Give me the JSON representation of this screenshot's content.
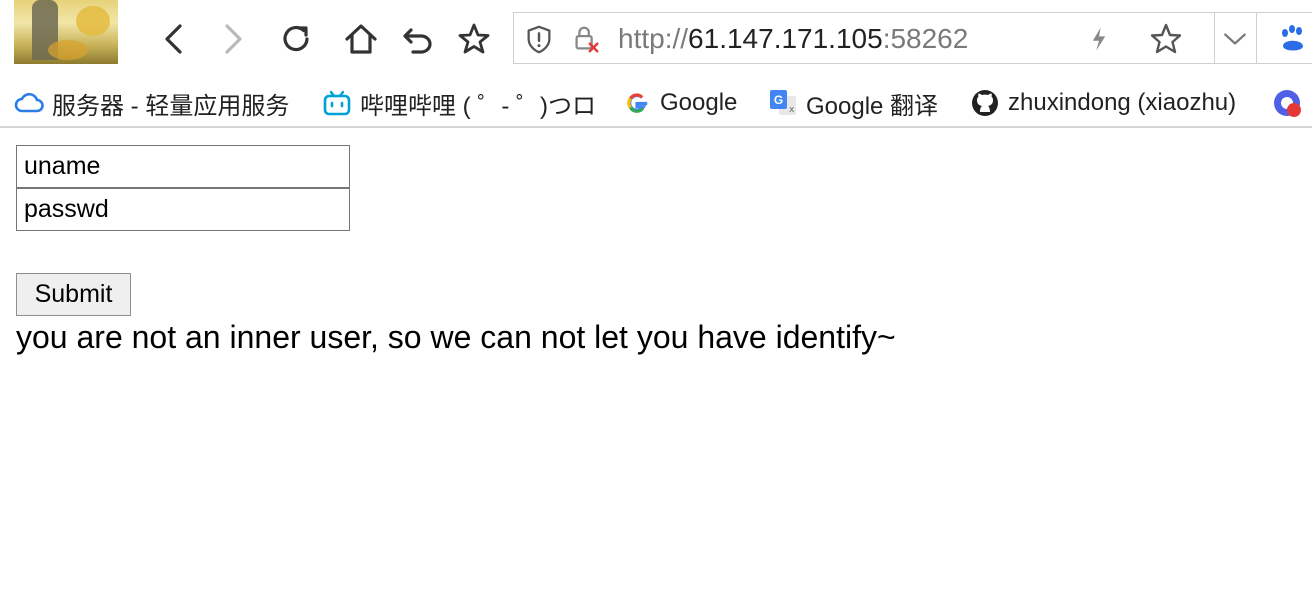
{
  "browser": {
    "url": {
      "scheme": "http://",
      "host": "61.147.171.105",
      "port": ":58262"
    }
  },
  "bookmarks": [
    {
      "label": "服务器 - 轻量应用服务",
      "icon": "cloud-icon"
    },
    {
      "label": "哔哩哔哩 ( ゜- ゜)つロ",
      "icon": "bilibili-icon"
    },
    {
      "label": "Google",
      "icon": "google-icon"
    },
    {
      "label": "Google 翻译",
      "icon": "google-translate-icon"
    },
    {
      "label": "zhuxindong (xiaozhu)",
      "icon": "github-icon"
    }
  ],
  "form": {
    "uname_placeholder": "uname",
    "passwd_placeholder": "passwd",
    "submit_label": "Submit"
  },
  "message": "you are not an inner user, so we can not let you have identify~",
  "colors": {
    "accent_blue": "#2b7de9",
    "bilibili": "#00a1d6",
    "text": "#000000"
  }
}
